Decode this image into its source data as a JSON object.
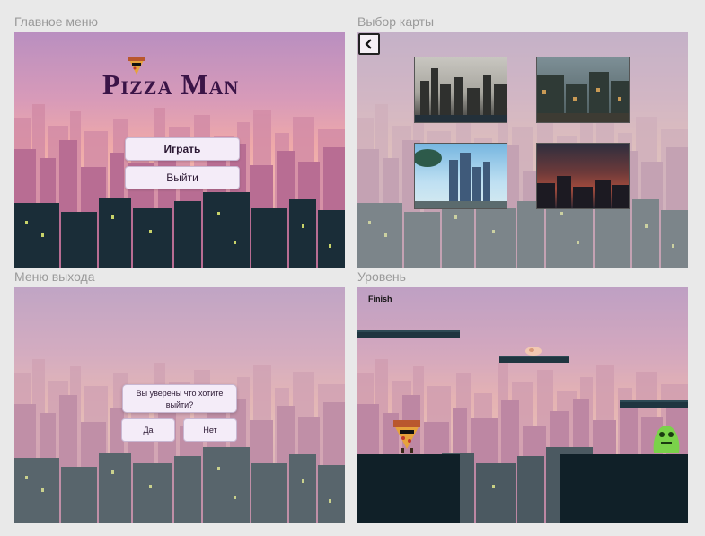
{
  "panels": {
    "main_menu": {
      "title": "Главное меню",
      "logo": "Pizza Man",
      "play_label": "Играть",
      "exit_label": "Выйти"
    },
    "map_select": {
      "title": "Выбор карты",
      "back_icon": "chevron-left-icon",
      "maps": [
        "city-day-gray",
        "city-street",
        "city-sky-blue",
        "city-sunset-red"
      ]
    },
    "exit_menu": {
      "title": "Меню выхода",
      "question": "Вы уверены что хотите выйти?",
      "yes_label": "Да",
      "no_label": "Нет"
    },
    "level": {
      "title": "Уровень",
      "finish_label": "Finish"
    }
  },
  "colors": {
    "accent": "#3a1447",
    "button_bg": "#f4ecf8",
    "sky_top": "#b98fc0",
    "sky_bottom": "#efa9a9"
  }
}
